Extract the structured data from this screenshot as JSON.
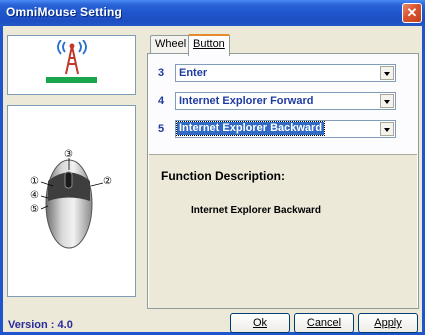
{
  "window": {
    "title": "OmniMouse Setting"
  },
  "tabs": [
    {
      "label": "Wheel"
    },
    {
      "label": "Button",
      "active": true
    }
  ],
  "buttons": [
    {
      "number": "3",
      "value": "Enter"
    },
    {
      "number": "4",
      "value": "Internet Explorer Forward"
    },
    {
      "number": "5",
      "value": "Internet Explorer Backward",
      "focused": true
    }
  ],
  "description": {
    "title": "Function Description:",
    "text": "Internet Explorer Backward"
  },
  "mouse_callouts": [
    "③",
    "①",
    "②",
    "④",
    "⑤"
  ],
  "footer": {
    "version": "Version : 4.0",
    "ok": "Ok",
    "cancel": "Cancel",
    "apply": "Apply"
  },
  "colors": {
    "accent": "#1F55CC",
    "label": "#1E3CA0",
    "logo_bar": "#1BA54C"
  }
}
